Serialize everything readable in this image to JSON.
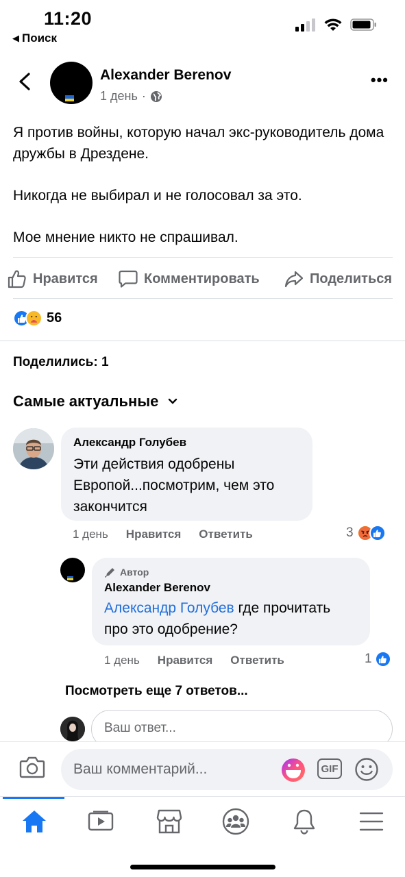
{
  "status_bar": {
    "time": "11:20",
    "back_app": "Поиск"
  },
  "post": {
    "author": "Alexander Berenov",
    "time": "1 день",
    "privacy_icon": "globe-icon",
    "paragraphs": [
      "Я против войны, которую начал экс-руководитель дома дружбы в Дрездене.",
      "Никогда не выбирал и не голосовал за это.",
      "Мое мнение никто не спрашивал."
    ],
    "actions": {
      "like": "Нравится",
      "comment": "Комментировать",
      "share": "Поделиться"
    },
    "reaction_count": "56",
    "shares_label": "Поделились: 1"
  },
  "comments_sort": "Самые актуальные",
  "comments": [
    {
      "author": "Александр Голубев",
      "text": "Эти действия одобрены Европой...посмотрим, чем это закончится",
      "time": "1 день",
      "like": "Нравится",
      "reply": "Ответить",
      "reaction_count": "3"
    }
  ],
  "reply": {
    "badge": "Автор",
    "author": "Alexander Berenov",
    "mention": "Александр Голубев",
    "text": " где прочитать про это одобрение?",
    "time": "1 день",
    "like": "Нравится",
    "reply": "Ответить",
    "reaction_count": "1"
  },
  "more_replies": "Посмотреть еще 7 ответов...",
  "reply_placeholder": "Ваш ответ...",
  "composer_placeholder": "Ваш комментарий...",
  "composer_gif": "GIF",
  "colors": {
    "facebook_blue": "#1877f2",
    "mention_blue": "#216fdb",
    "secondary_text": "#65676b",
    "bubble_bg": "#f0f2f5"
  }
}
